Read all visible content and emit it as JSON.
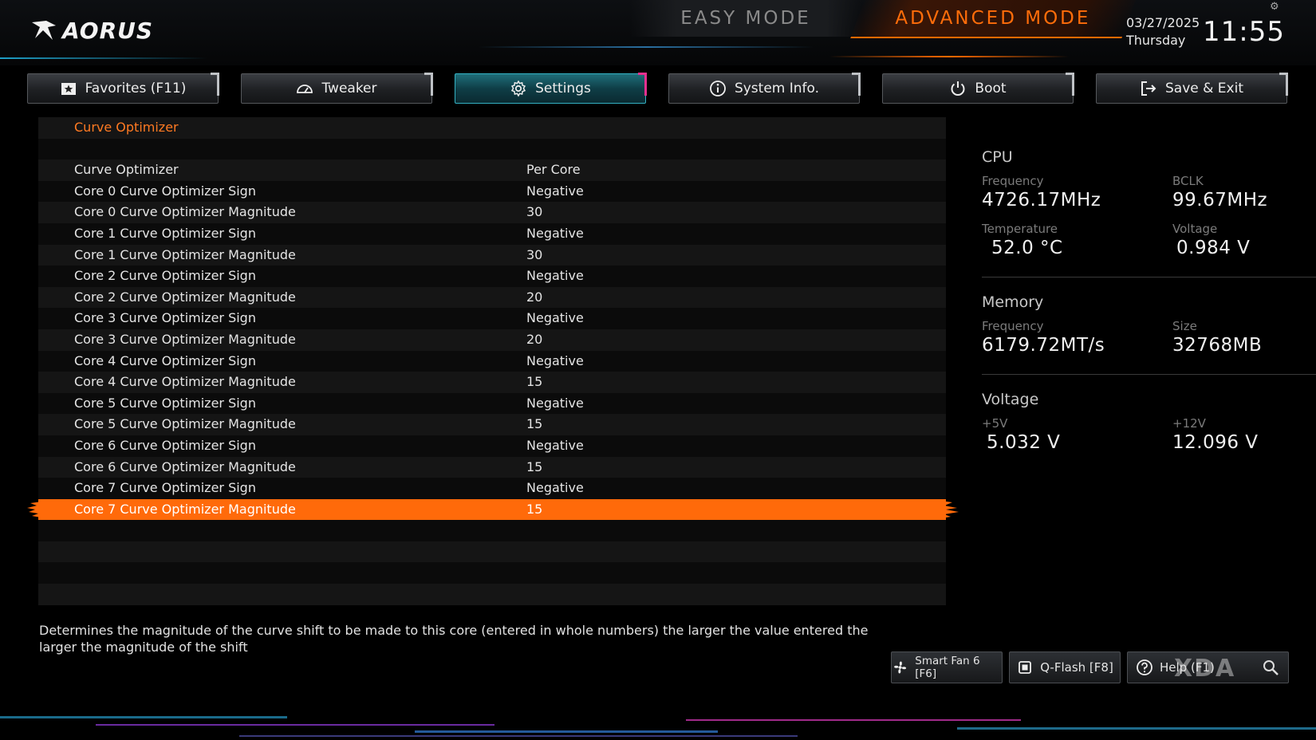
{
  "brand": {
    "name": "AORUS"
  },
  "modes": {
    "easy": "EASY MODE",
    "advanced": "ADVANCED MODE"
  },
  "datetime": {
    "date": "03/27/2025",
    "day": "Thursday",
    "time": "11:55"
  },
  "tabs": [
    {
      "label": "Favorites (F11)",
      "icon": "star-folder-icon"
    },
    {
      "label": "Tweaker",
      "icon": "speedometer-icon"
    },
    {
      "label": "Settings",
      "icon": "gear-icon",
      "active": true
    },
    {
      "label": "System Info.",
      "icon": "info-icon"
    },
    {
      "label": "Boot",
      "icon": "power-icon"
    },
    {
      "label": "Save & Exit",
      "icon": "exit-icon"
    }
  ],
  "settings": {
    "section_title": "Curve Optimizer",
    "rows": [
      {
        "name": "Curve Optimizer",
        "value": "Per Core"
      },
      {
        "name": "Core 0 Curve Optimizer Sign",
        "value": "Negative"
      },
      {
        "name": "Core 0 Curve Optimizer Magnitude",
        "value": "30"
      },
      {
        "name": "Core 1 Curve Optimizer Sign",
        "value": "Negative"
      },
      {
        "name": "Core 1 Curve Optimizer Magnitude",
        "value": "30"
      },
      {
        "name": "Core 2 Curve Optimizer Sign",
        "value": "Negative"
      },
      {
        "name": "Core 2 Curve Optimizer Magnitude",
        "value": "20"
      },
      {
        "name": "Core 3 Curve Optimizer Sign",
        "value": "Negative"
      },
      {
        "name": "Core 3 Curve Optimizer Magnitude",
        "value": "20"
      },
      {
        "name": "Core 4 Curve Optimizer Sign",
        "value": "Negative"
      },
      {
        "name": "Core 4 Curve Optimizer Magnitude",
        "value": "15"
      },
      {
        "name": "Core 5 Curve Optimizer Sign",
        "value": "Negative"
      },
      {
        "name": "Core 5 Curve Optimizer Magnitude",
        "value": "15"
      },
      {
        "name": "Core 6 Curve Optimizer Sign",
        "value": "Negative"
      },
      {
        "name": "Core 6 Curve Optimizer Magnitude",
        "value": "15"
      },
      {
        "name": "Core 7 Curve Optimizer Sign",
        "value": "Negative"
      },
      {
        "name": "Core 7 Curve Optimizer Magnitude",
        "value": "15",
        "selected": true
      }
    ]
  },
  "description": "Determines the magnitude of the curve shift to be made to this core (entered in whole numbers) the larger the value entered the larger the magnitude of the shift",
  "info": {
    "cpu": {
      "title": "CPU",
      "frequency_label": "Frequency",
      "frequency": "4726.17MHz",
      "bclk_label": "BCLK",
      "bclk": "99.67MHz",
      "temperature_label": "Temperature",
      "temperature": "52.0 °C",
      "voltage_label": "Voltage",
      "voltage": "0.984 V"
    },
    "memory": {
      "title": "Memory",
      "frequency_label": "Frequency",
      "frequency": "6179.72MT/s",
      "size_label": "Size",
      "size": "32768MB"
    },
    "voltage": {
      "title": "Voltage",
      "v5_label": "+5V",
      "v5": "5.032 V",
      "v12_label": "+12V",
      "v12": "12.096 V"
    }
  },
  "bottom_buttons": {
    "smart_fan": "Smart Fan 6 [F6]",
    "qflash": "Q-Flash [F8]",
    "help": "Help (F1)"
  },
  "watermark": "XDA",
  "colors": {
    "accent": "#ff6a0a",
    "active_tab": "#1f6e7a",
    "active_tab_corner": "#e6308f"
  }
}
